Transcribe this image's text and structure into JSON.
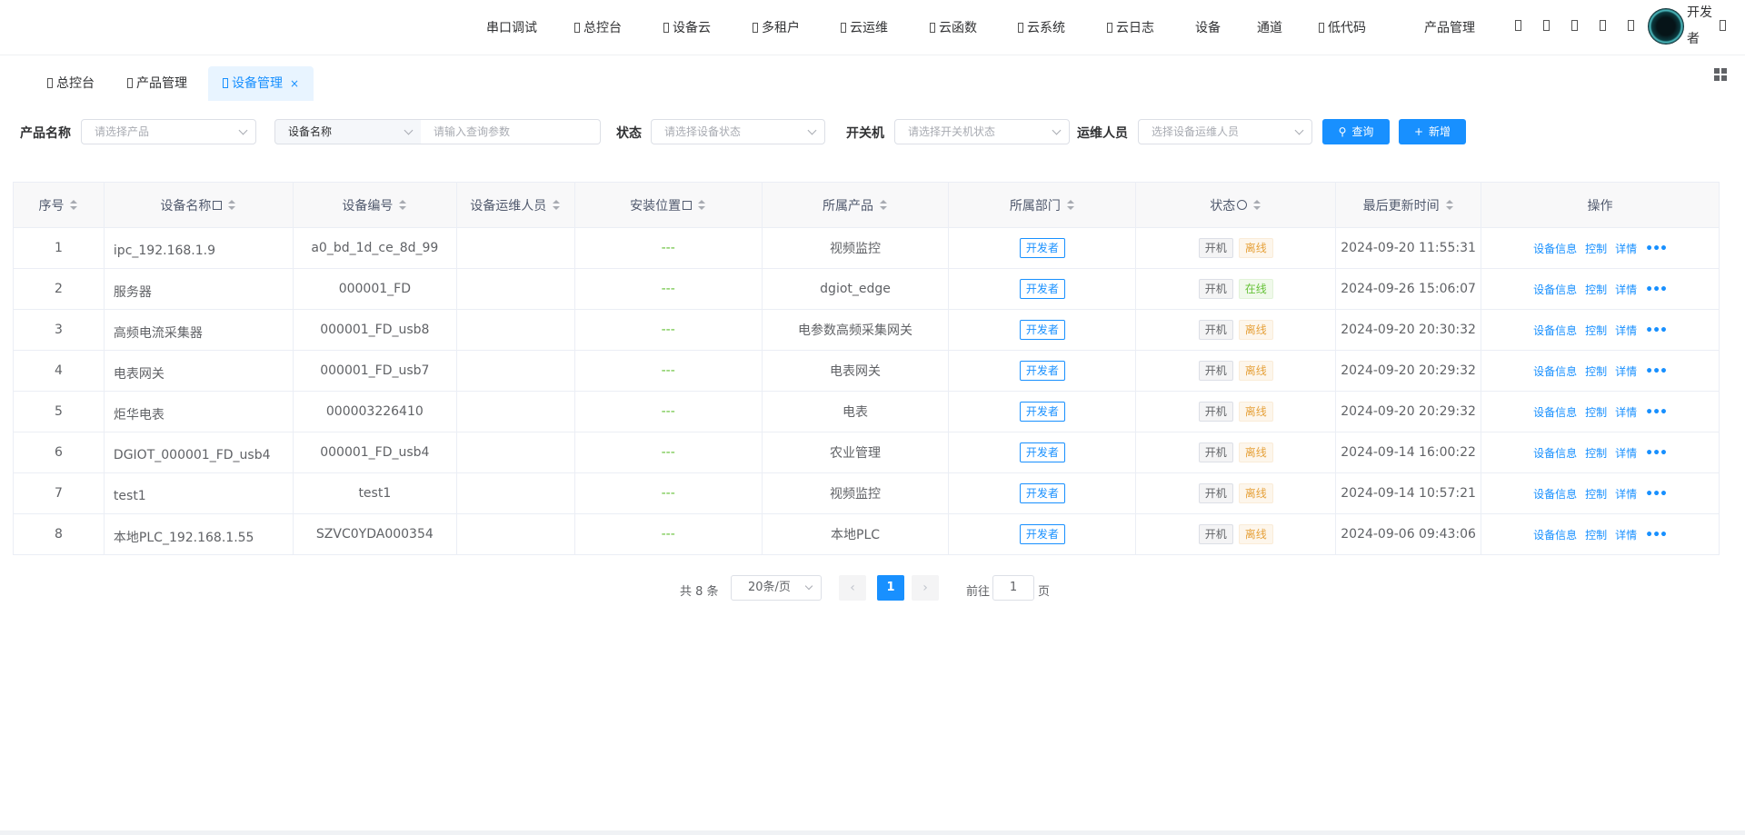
{
  "nav": {
    "items": [
      {
        "label": "串口调试",
        "icon": false
      },
      {
        "label": "总控台",
        "icon": true
      },
      {
        "label": "设备云",
        "icon": true
      },
      {
        "label": "多租户",
        "icon": true
      },
      {
        "label": "云运维",
        "icon": true
      },
      {
        "label": "云函数",
        "icon": true
      },
      {
        "label": "云系统",
        "icon": true
      },
      {
        "label": "云日志",
        "icon": true
      },
      {
        "label": "设备",
        "icon": false
      },
      {
        "label": "通道",
        "icon": false
      },
      {
        "label": "低代码",
        "icon": true
      },
      {
        "label": "产品管理",
        "icon": false
      }
    ],
    "user": "开发者"
  },
  "tabs": [
    {
      "label": "总控台"
    },
    {
      "label": "产品管理"
    },
    {
      "label": "设备管理",
      "close": "×"
    }
  ],
  "filters": {
    "product_label": "产品名称",
    "product_placeholder": "请选择产品",
    "field_select": "设备名称",
    "query_placeholder": "请输入查询参数",
    "status_label": "状态",
    "status_placeholder": "请选择设备状态",
    "power_label": "开关机",
    "power_placeholder": "请选择开关机状态",
    "ops_label": "运维人员",
    "ops_placeholder": "选择设备运维人员",
    "search_button": "查询",
    "add_button": "新增"
  },
  "table": {
    "headers": {
      "index": "序号",
      "name": "设备名称",
      "code": "设备编号",
      "ops": "设备运维人员",
      "location": "安装位置",
      "product": "所属产品",
      "dept": "所属部门",
      "status": "状态",
      "updated": "最后更新时间",
      "actions": "操作"
    },
    "dash": "---",
    "actions": {
      "info": "设备信息",
      "control": "控制",
      "detail": "详情",
      "more": "•••"
    },
    "rows": [
      {
        "index": "1",
        "name": "ipc_192.168.1.9",
        "code": "a0_bd_1d_ce_8d_99",
        "product": "视频监控",
        "dept": "开发者",
        "power": "开机",
        "status": "离线",
        "online": false,
        "updated": "2024-09-20 11:55:31"
      },
      {
        "index": "2",
        "name": "服务器",
        "code": "000001_FD",
        "product": "dgiot_edge",
        "dept": "开发者",
        "power": "开机",
        "status": "在线",
        "online": true,
        "updated": "2024-09-26 15:06:07"
      },
      {
        "index": "3",
        "name": "高频电流采集器",
        "code": "000001_FD_usb8",
        "product": "电参数高频采集网关",
        "dept": "开发者",
        "power": "开机",
        "status": "离线",
        "online": false,
        "updated": "2024-09-20 20:30:32"
      },
      {
        "index": "4",
        "name": "电表网关",
        "code": "000001_FD_usb7",
        "product": "电表网关",
        "dept": "开发者",
        "power": "开机",
        "status": "离线",
        "online": false,
        "updated": "2024-09-20 20:29:32"
      },
      {
        "index": "5",
        "name": "炬华电表",
        "code": "000003226410",
        "product": "电表",
        "dept": "开发者",
        "power": "开机",
        "status": "离线",
        "online": false,
        "updated": "2024-09-20 20:29:32"
      },
      {
        "index": "6",
        "name": "DGIOT_000001_FD_usb4",
        "code": "000001_FD_usb4",
        "product": "农业管理",
        "dept": "开发者",
        "power": "开机",
        "status": "离线",
        "online": false,
        "updated": "2024-09-14 16:00:22"
      },
      {
        "index": "7",
        "name": "test1",
        "code": "test1",
        "product": "视频监控",
        "dept": "开发者",
        "power": "开机",
        "status": "离线",
        "online": false,
        "updated": "2024-09-14 10:57:21"
      },
      {
        "index": "8",
        "name": "本地PLC_192.168.1.55",
        "code": "SZVC0YDA000354",
        "product": "本地PLC",
        "dept": "开发者",
        "power": "开机",
        "status": "离线",
        "online": false,
        "updated": "2024-09-06 09:43:06"
      }
    ]
  },
  "pagination": {
    "total": "共 8 条",
    "page_size": "20条/页",
    "current": "1",
    "goto_prefix": "前往",
    "goto_value": "1",
    "goto_suffix": "页",
    "prev": "‹",
    "next": "›"
  },
  "colors": {
    "primary": "#1890ff",
    "offline": "#e6a23c",
    "online": "#67c23a"
  }
}
